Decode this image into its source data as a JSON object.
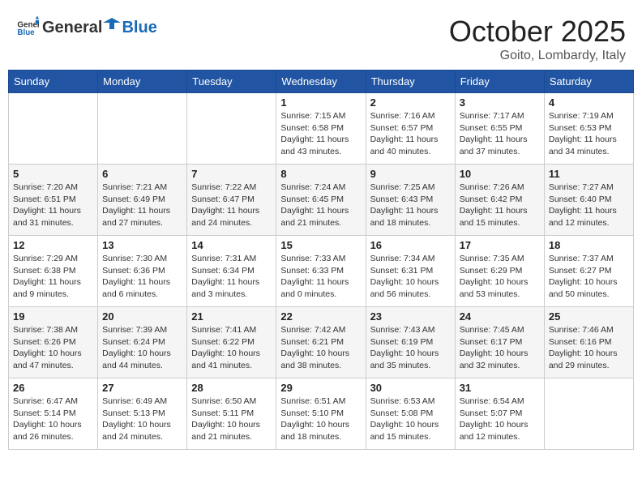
{
  "header": {
    "logo_general": "General",
    "logo_blue": "Blue",
    "month": "October 2025",
    "location": "Goito, Lombardy, Italy"
  },
  "days_of_week": [
    "Sunday",
    "Monday",
    "Tuesday",
    "Wednesday",
    "Thursday",
    "Friday",
    "Saturday"
  ],
  "weeks": [
    [
      {
        "day": "",
        "info": ""
      },
      {
        "day": "",
        "info": ""
      },
      {
        "day": "",
        "info": ""
      },
      {
        "day": "1",
        "info": "Sunrise: 7:15 AM\nSunset: 6:58 PM\nDaylight: 11 hours and 43 minutes."
      },
      {
        "day": "2",
        "info": "Sunrise: 7:16 AM\nSunset: 6:57 PM\nDaylight: 11 hours and 40 minutes."
      },
      {
        "day": "3",
        "info": "Sunrise: 7:17 AM\nSunset: 6:55 PM\nDaylight: 11 hours and 37 minutes."
      },
      {
        "day": "4",
        "info": "Sunrise: 7:19 AM\nSunset: 6:53 PM\nDaylight: 11 hours and 34 minutes."
      }
    ],
    [
      {
        "day": "5",
        "info": "Sunrise: 7:20 AM\nSunset: 6:51 PM\nDaylight: 11 hours and 31 minutes."
      },
      {
        "day": "6",
        "info": "Sunrise: 7:21 AM\nSunset: 6:49 PM\nDaylight: 11 hours and 27 minutes."
      },
      {
        "day": "7",
        "info": "Sunrise: 7:22 AM\nSunset: 6:47 PM\nDaylight: 11 hours and 24 minutes."
      },
      {
        "day": "8",
        "info": "Sunrise: 7:24 AM\nSunset: 6:45 PM\nDaylight: 11 hours and 21 minutes."
      },
      {
        "day": "9",
        "info": "Sunrise: 7:25 AM\nSunset: 6:43 PM\nDaylight: 11 hours and 18 minutes."
      },
      {
        "day": "10",
        "info": "Sunrise: 7:26 AM\nSunset: 6:42 PM\nDaylight: 11 hours and 15 minutes."
      },
      {
        "day": "11",
        "info": "Sunrise: 7:27 AM\nSunset: 6:40 PM\nDaylight: 11 hours and 12 minutes."
      }
    ],
    [
      {
        "day": "12",
        "info": "Sunrise: 7:29 AM\nSunset: 6:38 PM\nDaylight: 11 hours and 9 minutes."
      },
      {
        "day": "13",
        "info": "Sunrise: 7:30 AM\nSunset: 6:36 PM\nDaylight: 11 hours and 6 minutes."
      },
      {
        "day": "14",
        "info": "Sunrise: 7:31 AM\nSunset: 6:34 PM\nDaylight: 11 hours and 3 minutes."
      },
      {
        "day": "15",
        "info": "Sunrise: 7:33 AM\nSunset: 6:33 PM\nDaylight: 11 hours and 0 minutes."
      },
      {
        "day": "16",
        "info": "Sunrise: 7:34 AM\nSunset: 6:31 PM\nDaylight: 10 hours and 56 minutes."
      },
      {
        "day": "17",
        "info": "Sunrise: 7:35 AM\nSunset: 6:29 PM\nDaylight: 10 hours and 53 minutes."
      },
      {
        "day": "18",
        "info": "Sunrise: 7:37 AM\nSunset: 6:27 PM\nDaylight: 10 hours and 50 minutes."
      }
    ],
    [
      {
        "day": "19",
        "info": "Sunrise: 7:38 AM\nSunset: 6:26 PM\nDaylight: 10 hours and 47 minutes."
      },
      {
        "day": "20",
        "info": "Sunrise: 7:39 AM\nSunset: 6:24 PM\nDaylight: 10 hours and 44 minutes."
      },
      {
        "day": "21",
        "info": "Sunrise: 7:41 AM\nSunset: 6:22 PM\nDaylight: 10 hours and 41 minutes."
      },
      {
        "day": "22",
        "info": "Sunrise: 7:42 AM\nSunset: 6:21 PM\nDaylight: 10 hours and 38 minutes."
      },
      {
        "day": "23",
        "info": "Sunrise: 7:43 AM\nSunset: 6:19 PM\nDaylight: 10 hours and 35 minutes."
      },
      {
        "day": "24",
        "info": "Sunrise: 7:45 AM\nSunset: 6:17 PM\nDaylight: 10 hours and 32 minutes."
      },
      {
        "day": "25",
        "info": "Sunrise: 7:46 AM\nSunset: 6:16 PM\nDaylight: 10 hours and 29 minutes."
      }
    ],
    [
      {
        "day": "26",
        "info": "Sunrise: 6:47 AM\nSunset: 5:14 PM\nDaylight: 10 hours and 26 minutes."
      },
      {
        "day": "27",
        "info": "Sunrise: 6:49 AM\nSunset: 5:13 PM\nDaylight: 10 hours and 24 minutes."
      },
      {
        "day": "28",
        "info": "Sunrise: 6:50 AM\nSunset: 5:11 PM\nDaylight: 10 hours and 21 minutes."
      },
      {
        "day": "29",
        "info": "Sunrise: 6:51 AM\nSunset: 5:10 PM\nDaylight: 10 hours and 18 minutes."
      },
      {
        "day": "30",
        "info": "Sunrise: 6:53 AM\nSunset: 5:08 PM\nDaylight: 10 hours and 15 minutes."
      },
      {
        "day": "31",
        "info": "Sunrise: 6:54 AM\nSunset: 5:07 PM\nDaylight: 10 hours and 12 minutes."
      },
      {
        "day": "",
        "info": ""
      }
    ]
  ]
}
